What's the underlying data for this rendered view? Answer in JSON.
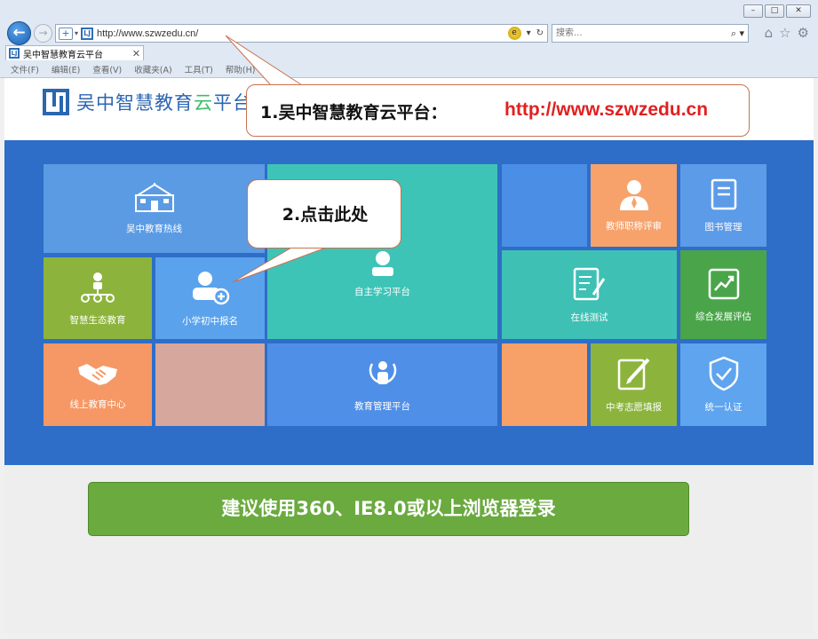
{
  "browser": {
    "address": "http://www.szwzedu.cn/",
    "search_placeholder": "搜索...",
    "tab_title": "吴中智慧教育云平台",
    "menu": [
      "文件(F)",
      "编辑(E)",
      "查看(V)",
      "收藏夹(A)",
      "工具(T)",
      "帮助(H)"
    ]
  },
  "site": {
    "logo_text_main": "吴中智慧教育",
    "logo_text_cloud": "云",
    "logo_text_end": "平台"
  },
  "tiles": {
    "hotline": "吴中教育热线",
    "study": "自主学习平台",
    "title_review": "教师职称评审",
    "library": "图书管理",
    "eco": "智慧生态教育",
    "enroll": "小学初中报名",
    "online_test": "在线测试",
    "evaluation": "综合发展评估",
    "online_center": "线上教育中心",
    "admin": "教育管理平台",
    "zhongkao": "中考志愿填报",
    "auth": "统一认证"
  },
  "callouts": {
    "step1_text": "1.吴中智慧教育云平台：",
    "step1_url": "http://www.szwzedu.cn",
    "step2_text": "2.点击此处"
  },
  "notice": "建议使用360、IE8.0或以上浏览器登录",
  "colors": {
    "main_bg": "#2e6ec8",
    "accent_red": "#e02020",
    "notice_green": "#6aaa3f"
  }
}
